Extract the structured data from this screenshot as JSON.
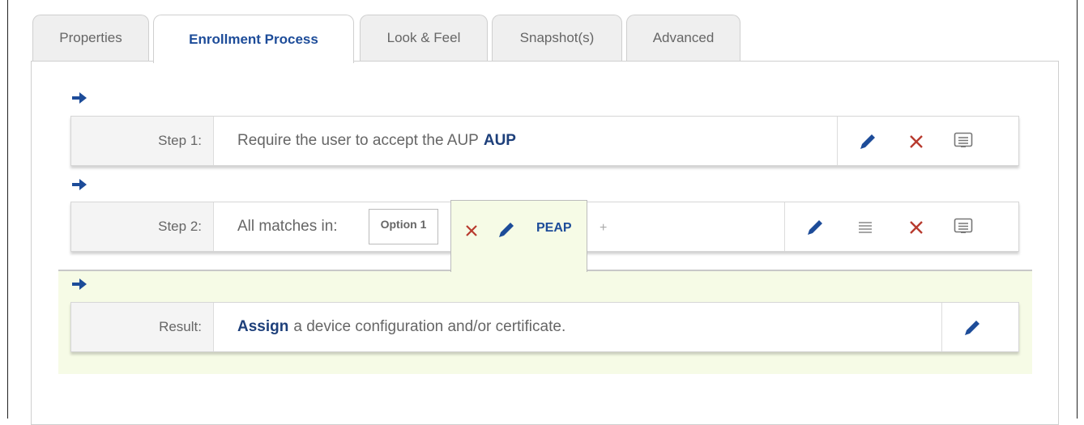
{
  "tabs": [
    {
      "label": "Properties"
    },
    {
      "label": "Enrollment Process"
    },
    {
      "label": "Look & Feel"
    },
    {
      "label": "Snapshot(s)"
    },
    {
      "label": "Advanced"
    }
  ],
  "active_tab": "Enrollment Process",
  "steps": [
    {
      "label": "Step 1:",
      "text": "Require the user to accept the AUP",
      "emphasis": "AUP"
    },
    {
      "label": "Step 2:",
      "text": "All matches in:",
      "option": "Option 1",
      "chip": "PEAP",
      "add": "+"
    }
  ],
  "result": {
    "label": "Result:",
    "lead": "Assign",
    "text": "a device configuration and/or certificate."
  },
  "colors": {
    "accent_blue": "#1d4c99",
    "delete_red": "#b83a2e",
    "result_bg": "#f6fbe6",
    "label_bg": "#f4f4f4"
  },
  "icons": [
    "arrow-right-icon",
    "pencil-icon",
    "close-icon",
    "comment-icon",
    "menu-lines-icon"
  ]
}
